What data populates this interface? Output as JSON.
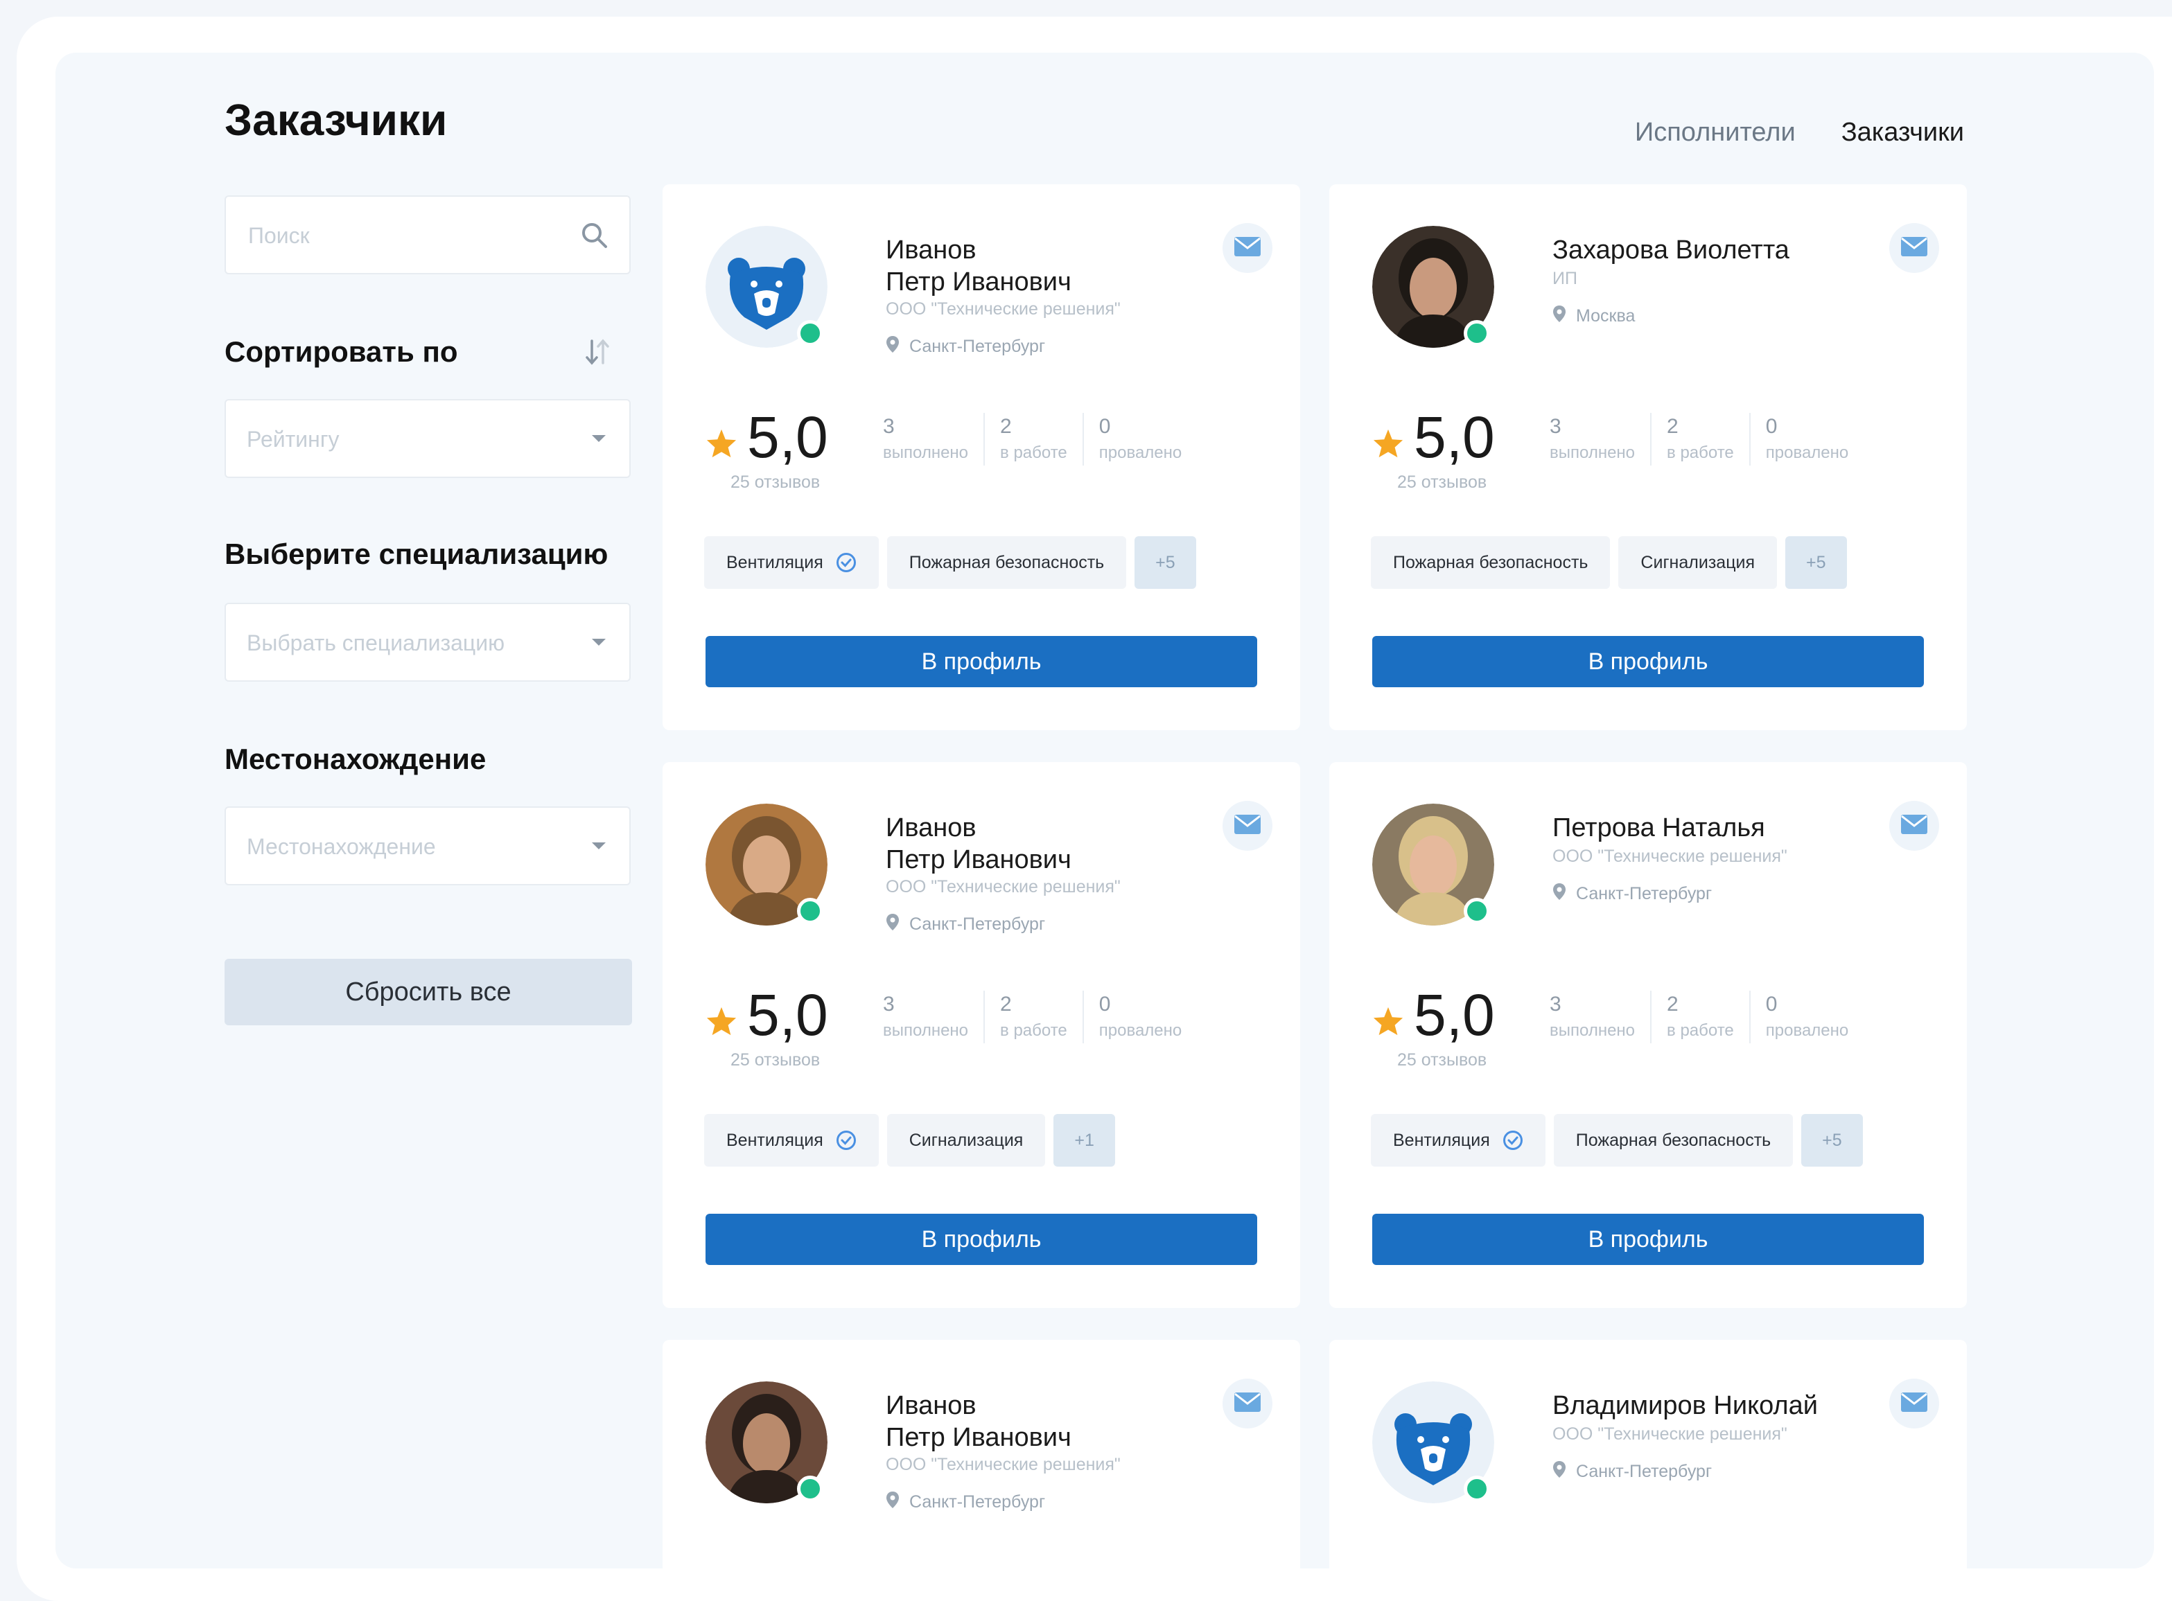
{
  "page": {
    "title": "Заказчики",
    "tabs": [
      {
        "label": "Исполнители",
        "active": false
      },
      {
        "label": "Заказчики",
        "active": true
      }
    ]
  },
  "sidebar": {
    "search_placeholder": "Поиск",
    "sort_label": "Сортировать по",
    "sort_value": "Рейтингу",
    "spec_label": "Выберите специализацию",
    "spec_placeholder": "Выбрать специализацию",
    "location_label": "Местонахождение",
    "location_placeholder": "Местонахождение",
    "reset_label": "Сбросить все"
  },
  "cards": [
    {
      "name": "Иванов\nПетр Иванович",
      "subtitle": "ООО \"Технические решения\"",
      "location": "Санкт-Петербург",
      "avatar": "bear-logo",
      "rating": "5,0",
      "reviews": "25 отзывов",
      "stats": [
        {
          "n": "3",
          "t": "выполнено"
        },
        {
          "n": "2",
          "t": "в работе"
        },
        {
          "n": "0",
          "t": "провалено"
        }
      ],
      "tags": [
        {
          "label": "Вентиляция",
          "verified": true
        },
        {
          "label": "Пожарная безопасность",
          "verified": false
        }
      ],
      "more": "+5",
      "button": "В профиль"
    },
    {
      "name": "Захарова Виолетта",
      "subtitle": "ИП",
      "location": "Москва",
      "avatar": "photo-woman-dark-hair",
      "rating": "5,0",
      "reviews": "25 отзывов",
      "stats": [
        {
          "n": "3",
          "t": "выполнено"
        },
        {
          "n": "2",
          "t": "в работе"
        },
        {
          "n": "0",
          "t": "провалено"
        }
      ],
      "tags": [
        {
          "label": "Пожарная безопасность",
          "verified": false
        },
        {
          "label": "Сигнализация",
          "verified": false
        }
      ],
      "more": "+5",
      "button": "В профиль"
    },
    {
      "name": "Иванов\nПетр Иванович",
      "subtitle": "ООО \"Технические решения\"",
      "location": "Санкт-Петербург",
      "avatar": "photo-man-glasses",
      "rating": "5,0",
      "reviews": "25 отзывов",
      "stats": [
        {
          "n": "3",
          "t": "выполнено"
        },
        {
          "n": "2",
          "t": "в работе"
        },
        {
          "n": "0",
          "t": "провалено"
        }
      ],
      "tags": [
        {
          "label": "Вентиляция",
          "verified": true
        },
        {
          "label": "Сигнализация",
          "verified": false
        }
      ],
      "more": "+1",
      "button": "В профиль"
    },
    {
      "name": "Петрова Наталья",
      "subtitle": "ООО \"Технические решения\"",
      "location": "Санкт-Петербург",
      "avatar": "photo-woman-blonde",
      "rating": "5,0",
      "reviews": "25 отзывов",
      "stats": [
        {
          "n": "3",
          "t": "выполнено"
        },
        {
          "n": "2",
          "t": "в работе"
        },
        {
          "n": "0",
          "t": "провалено"
        }
      ],
      "tags": [
        {
          "label": "Вентиляция",
          "verified": true
        },
        {
          "label": "Пожарная безопасность",
          "verified": false
        }
      ],
      "more": "+5",
      "button": "В профиль"
    },
    {
      "name": "Иванов\nПетр Иванович",
      "subtitle": "ООО \"Технические решения\"",
      "location": "Санкт-Петербург",
      "avatar": "photo-man-beard",
      "partial": true
    },
    {
      "name": "Владимиров Николай",
      "subtitle": "ООО \"Технические решения\"",
      "location": "Санкт-Петербург",
      "avatar": "bear-logo",
      "partial": true
    }
  ],
  "colors": {
    "accent": "#1b6fc2",
    "online": "#1ebf8b",
    "star": "#f5a623",
    "background": "#f4f8fc"
  }
}
